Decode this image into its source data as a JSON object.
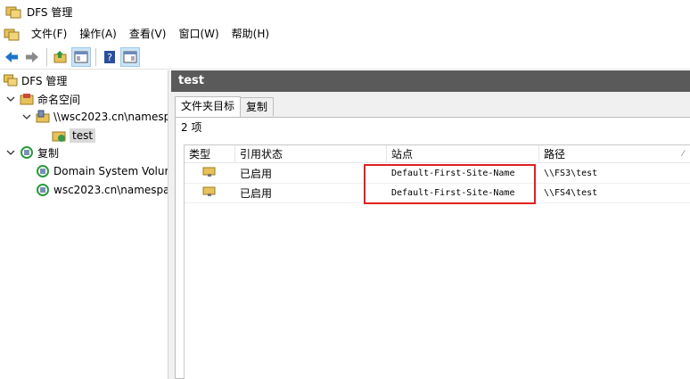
{
  "window": {
    "title": "DFS 管理"
  },
  "menu": [
    {
      "label": "文件(F)"
    },
    {
      "label": "操作(A)"
    },
    {
      "label": "查看(V)"
    },
    {
      "label": "窗口(W)"
    },
    {
      "label": "帮助(H)"
    }
  ],
  "toolbar": {
    "buttons": [
      "back-arrow-icon",
      "forward-arrow-icon",
      "up-folder-icon",
      "show-hide-tree-icon",
      "help-icon",
      "action-pane-icon"
    ]
  },
  "tree": {
    "root": "DFS 管理",
    "namespaces": "命名空间",
    "namespace_item": "\\\\wsc2023.cn\\namesp",
    "folder_item": "test",
    "replication": "复制",
    "rep_item_1": "Domain System Volur",
    "rep_item_2": "wsc2023.cn\\namespa"
  },
  "details": {
    "header_title": "test",
    "tabs": [
      {
        "label": "文件夹目标",
        "active": true
      },
      {
        "label": "复制",
        "active": false
      }
    ],
    "count_label": "2 项",
    "columns": [
      "类型",
      "引用状态",
      "站点",
      "路径"
    ],
    "rows": [
      {
        "status": "已启用",
        "site": "Default-First-Site-Name",
        "path": "\\\\FS3\\test"
      },
      {
        "status": "已启用",
        "site": "Default-First-Site-Name",
        "path": "\\\\FS4\\test"
      }
    ]
  },
  "colors": {
    "header_bar": "#5a5a5a",
    "highlight_box": "#e02020",
    "selected_bg": "#d9d9d9"
  }
}
